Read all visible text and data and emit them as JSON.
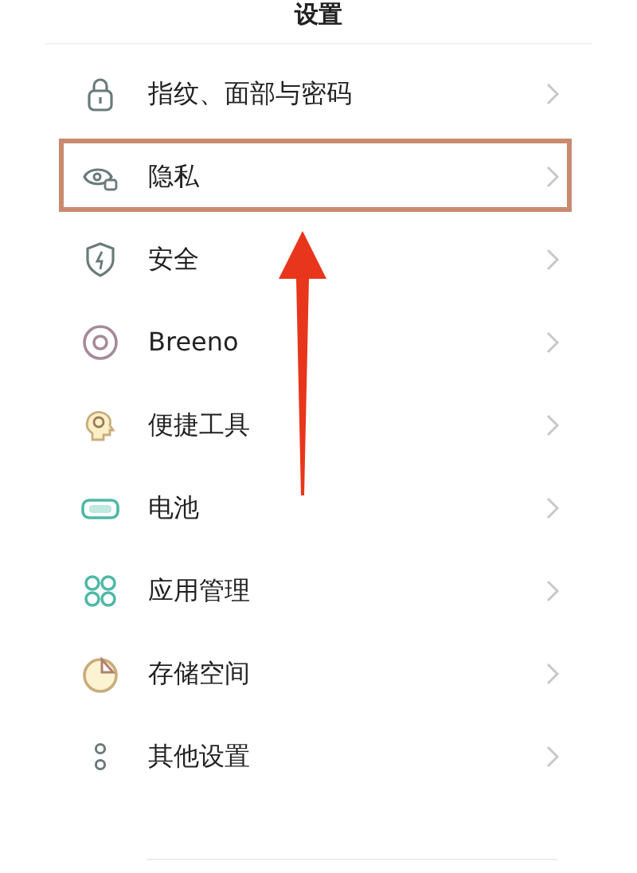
{
  "title": "设置",
  "items": [
    {
      "label": "指纹、面部与密码",
      "highlighted": false
    },
    {
      "label": "隐私",
      "highlighted": true
    },
    {
      "label": "安全",
      "highlighted": false
    },
    {
      "label": "Breeno",
      "highlighted": false
    },
    {
      "label": "便捷工具",
      "highlighted": false
    },
    {
      "label": "电池",
      "highlighted": false
    },
    {
      "label": "应用管理",
      "highlighted": false
    },
    {
      "label": "存储空间",
      "highlighted": false
    },
    {
      "label": "其他设置",
      "highlighted": false
    }
  ]
}
